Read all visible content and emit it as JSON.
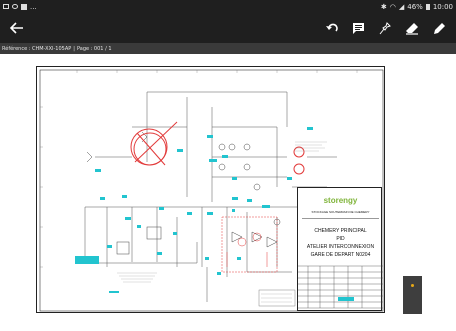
{
  "status_bar": {
    "time": "10:00",
    "battery": "46%",
    "ellipsis": "..."
  },
  "toolbar": {
    "back_icon": "arrow-left-icon",
    "undo_icon": "undo-icon",
    "comment_icon": "comment-icon",
    "pin_icon": "pin-icon",
    "eraser_icon": "eraser-icon",
    "pencil_icon": "pencil-icon"
  },
  "reference_bar": {
    "reference_label": "Référence : CHM-XXI-105AP",
    "separator": "|",
    "page_label": "Page : 001 / 1"
  },
  "title_block": {
    "logo": "storengy",
    "line1": "STOCKAGE SOUTERRAIN DE CHEMERY",
    "line2": "CHEMERY PRINCIPAL",
    "line3": "PID",
    "line4": "ATELIER INTERCONNEXION",
    "line5": "GARE DE DEPART N0204"
  },
  "colors": {
    "accent_cyan": "#22c4cf",
    "accent_red": "#e23a3a",
    "logo_orange": "#e6a817",
    "logo_green": "#7fb43a"
  }
}
